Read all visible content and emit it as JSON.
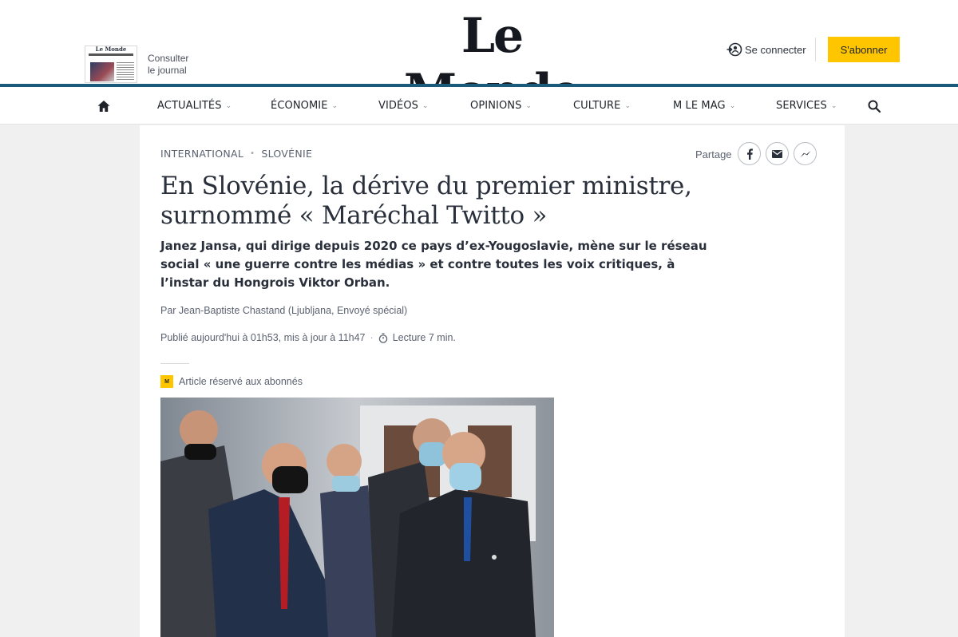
{
  "header": {
    "newspaper_thumb_title": "Le Monde",
    "consult_line1": "Consulter",
    "consult_line2": "le journal",
    "logo": "Le Monde",
    "login_label": "Se connecter",
    "login_icon": "login-icon",
    "subscribe_label": "S'abonner",
    "colors": {
      "accent_yellow": "#ffc600",
      "rule_blue": "#1a5a7a"
    }
  },
  "nav": {
    "home_icon": "home-icon",
    "search_icon": "search-icon",
    "items": [
      {
        "label": "ACTUALITÉS"
      },
      {
        "label": "ÉCONOMIE"
      },
      {
        "label": "VIDÉOS"
      },
      {
        "label": "OPINIONS"
      },
      {
        "label": "CULTURE"
      },
      {
        "label": "M LE MAG"
      },
      {
        "label": "SERVICES"
      }
    ]
  },
  "article": {
    "breadcrumb": [
      "INTERNATIONAL",
      "SLOVÉNIE"
    ],
    "share_label": "Partage",
    "share_icons": [
      "facebook-icon",
      "email-icon",
      "messenger-icon"
    ],
    "title_line1": "En Slovénie, la dérive du premier ministre,",
    "title_line2": "surnommé « Maréchal Twitto »",
    "description": "Janez Jansa, qui dirige depuis 2020 ce pays d’ex-Yougoslavie, mène sur le réseau social « une guerre contre les médias » et contre toutes les voix critiques, à l’instar du Hongrois Viktor Orban.",
    "author": "Par Jean-Baptiste Chastand (Ljubljana, Envoyé spécial)",
    "published": "Publié aujourd'hui à 01h53, mis à jour à 11h47",
    "reading_time": "Lecture 7 min.",
    "reserved_label": "Article réservé aux abonnés",
    "reserved_badge": "M"
  }
}
